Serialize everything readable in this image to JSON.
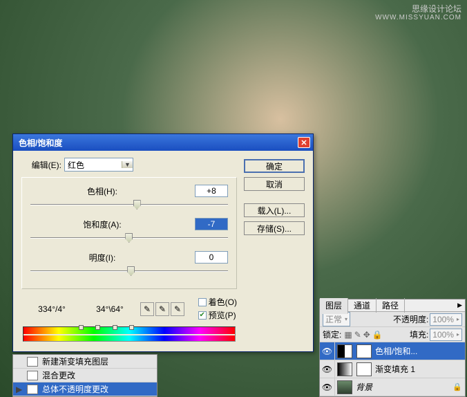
{
  "watermark": {
    "line1": "思缘设计论坛",
    "line2": "WWW.MISSYUAN.COM"
  },
  "dialog": {
    "title": "色相/饱和度",
    "edit_label": "编辑(E):",
    "edit_value": "红色",
    "hue_label": "色相(H):",
    "hue_value": "+8",
    "sat_label": "饱和度(A):",
    "sat_value": "-7",
    "light_label": "明度(I):",
    "light_value": "0",
    "angle_left": "334°/4°",
    "angle_right": "34°\\64°",
    "colorize_label": "着色(O)",
    "preview_label": "预览(P)",
    "preview_checked": true,
    "buttons": {
      "ok": "确定",
      "cancel": "取消",
      "load": "载入(L)...",
      "save": "存储(S)..."
    }
  },
  "history": {
    "items": [
      {
        "label": "新建渐变填充图层"
      },
      {
        "label": "混合更改"
      },
      {
        "label": "总体不透明度更改",
        "selected": true
      }
    ]
  },
  "layers_panel": {
    "tabs": [
      "图层",
      "通道",
      "路径"
    ],
    "blend_label": "正常",
    "opacity_label": "不透明度:",
    "opacity_value": "100%",
    "lock_label": "锁定:",
    "fill_label": "填充:",
    "fill_value": "100%",
    "layers": [
      {
        "name": "色相/饱和...",
        "type": "adj",
        "selected": true
      },
      {
        "name": "渐变填充 1",
        "type": "grad"
      },
      {
        "name": "背景",
        "type": "bg",
        "locked": true
      }
    ]
  }
}
